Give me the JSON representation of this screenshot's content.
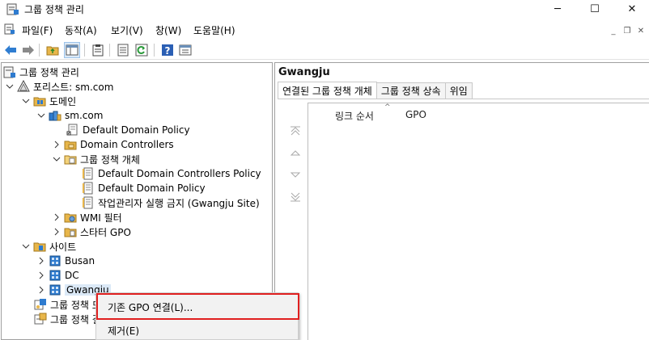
{
  "window": {
    "title": "그룹 정책 관리",
    "min_glyph": "─",
    "max_glyph": "☐",
    "close_glyph": "✕"
  },
  "menubar": {
    "items": [
      "파일(F)",
      "동작(A)",
      "보기(V)",
      "창(W)",
      "도움말(H)"
    ],
    "mdi_min": "_",
    "mdi_restore": "❐",
    "mdi_close": "✕"
  },
  "toolbar": {
    "icons": [
      "back-icon",
      "forward-icon",
      "up-folder-icon",
      "show-tree-icon",
      "clipboard-icon",
      "properties-icon",
      "refresh-icon",
      "help-icon",
      "console-icon"
    ]
  },
  "tree": {
    "root": "그룹 정책 관리",
    "forest": "포리스트: sm.com",
    "domains": "도메인",
    "domain": "sm.com",
    "ddp": "Default Domain Policy",
    "dc": "Domain Controllers",
    "gpo_container": "그룹 정책 개체",
    "gpo_ddcp": "Default Domain Controllers Policy",
    "gpo_ddp": "Default Domain Policy",
    "gpo_taskmgr": "작업관리자 실행 금지 (Gwangju Site)",
    "wmi": "WMI 필터",
    "starter": "스타터 GPO",
    "sites": "사이트",
    "site_busan": "Busan",
    "site_dc": "DC",
    "site_gwangju": "Gwangju",
    "gp_model_partial": "그룹 정책 모",
    "gp_result_partial": "그룹 정책 결"
  },
  "right_pane": {
    "title": "Gwangju",
    "tabs": [
      "연결된 그룹 정책 개체",
      "그룹 정책 상속",
      "위임"
    ],
    "columns": [
      "링크 순서",
      "GPO"
    ]
  },
  "context_menu": {
    "items": [
      "기존 GPO 연결(L)...",
      "제거(E)"
    ],
    "highlight_color": "#e02020"
  },
  "colors": {
    "border": "#a0a0a0",
    "menu_bg": "#f2f2f2",
    "folder": "#e8b64a",
    "site_blue": "#2e7bcf"
  }
}
